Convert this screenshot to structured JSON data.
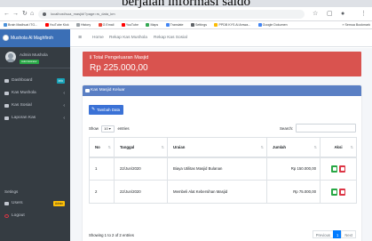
{
  "caption": "berjalan informasi saldo",
  "browser": {
    "url": "localhost/sua_masjid/?page=rs_data_km",
    "bookmarks": [
      "Brain Madhuai ITG...",
      "YouTube Kick",
      "History",
      "G Email",
      "YouTube",
      "Maps",
      "Translate",
      "Settings",
      "PPDB KYS Al Amwa...",
      "Google Dokumen"
    ],
    "bookmarks_more": "Semua Bookmark"
  },
  "sidebar": {
    "brand": "Mushola Al Maghfiroh",
    "user_name": "Admin Mushola",
    "user_badge": "Administrator",
    "items": [
      {
        "label": "Dashboard",
        "badge": "Info"
      },
      {
        "label": "Kas Mushola"
      },
      {
        "label": "Kas Sosial"
      },
      {
        "label": "Laporan Kas"
      }
    ],
    "header": "Setings",
    "settings_items": [
      {
        "label": "Users",
        "badge": "Admin"
      },
      {
        "label": "Logout"
      }
    ]
  },
  "topnav": {
    "links": [
      "Home",
      "Rekap Kas Mushola",
      "Rekap Kas Sosial"
    ]
  },
  "summary": {
    "title": "Total Pengeluaran Masjid",
    "value": "Rp 225.000,00"
  },
  "table_card": {
    "title": "Kas Masjid Keluar",
    "add_button": "Tambah Data",
    "show_label": "Show",
    "length_value": "10",
    "entries_label": "entries",
    "search_label": "Search:",
    "columns": [
      "No",
      "Tanggal",
      "Uraian",
      "Jumlah",
      "Aksi"
    ],
    "rows": [
      {
        "no": "1",
        "tanggal": "22/Jun/2020",
        "uraian": "Biaya Utilitas Masjid Bulanan",
        "jumlah": "Rp 150.000,00"
      },
      {
        "no": "2",
        "tanggal": "22/Jun/2020",
        "uraian": "Membeli Alat Kebersihan Masjid",
        "jumlah": "Rp 75.000,00"
      }
    ],
    "info": "Showing 1 to 2 of 2 entries",
    "pager": {
      "previous": "Previous",
      "page": "1",
      "next": "Next"
    }
  },
  "colors": {
    "sidebar": "#353c42",
    "brand": "#3b6fb6",
    "summary": "#d9534f",
    "card_header": "#5a7fc4",
    "primary": "#007bff",
    "edit": "#28a745",
    "delete": "#dc3545"
  }
}
